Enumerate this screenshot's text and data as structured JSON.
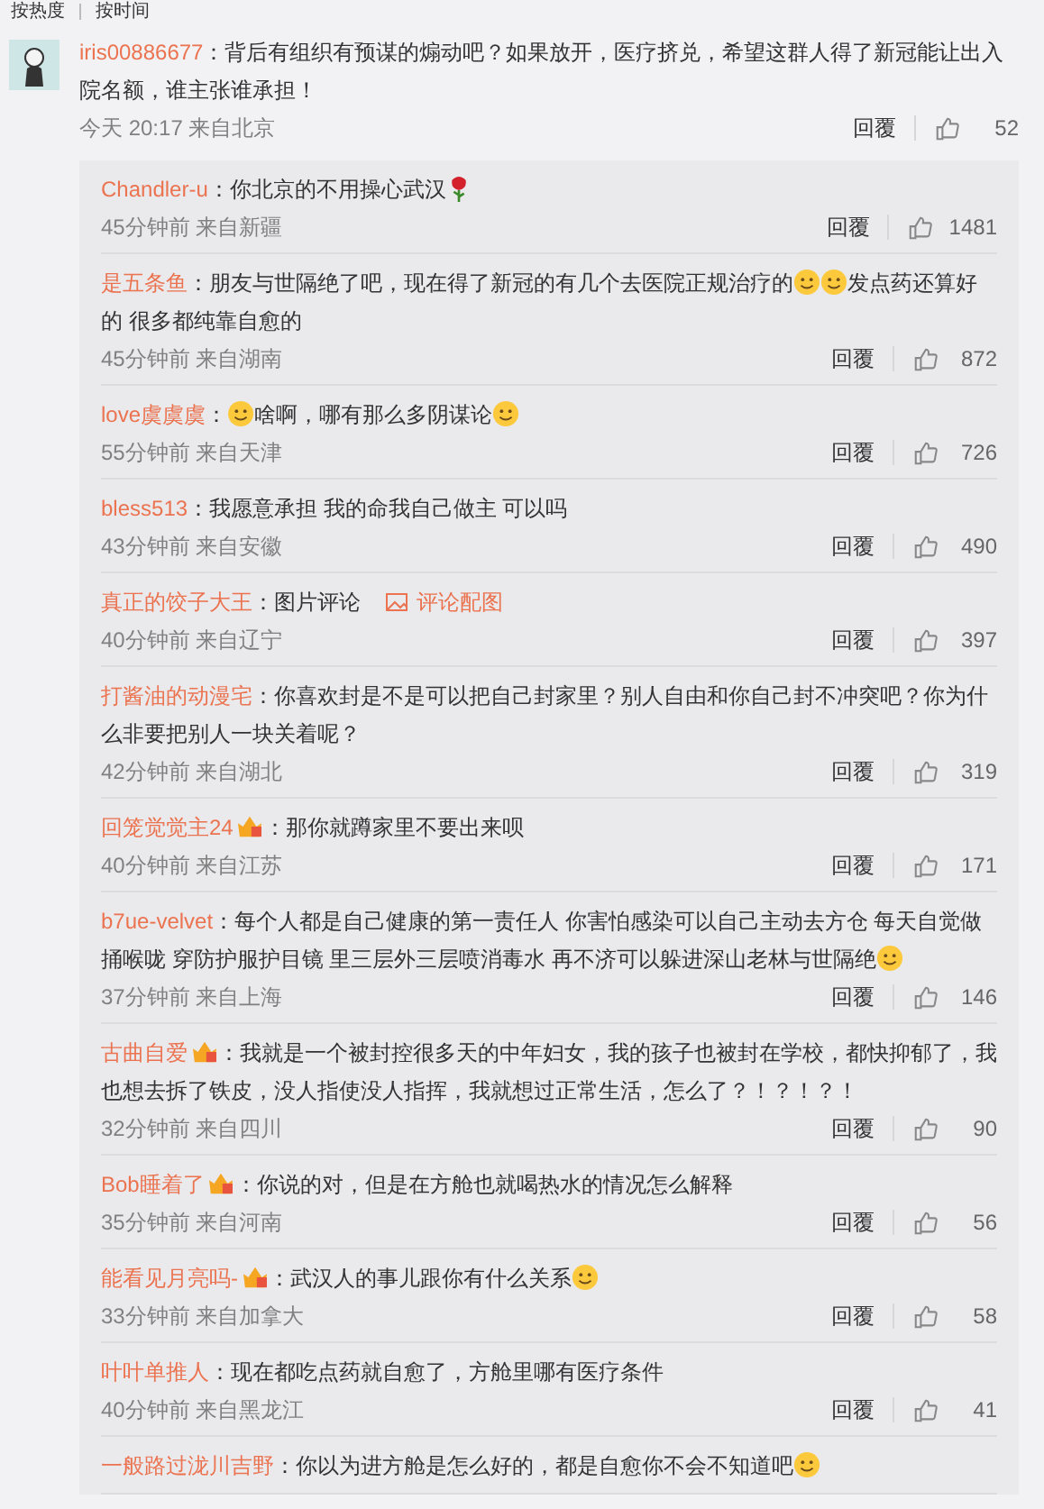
{
  "sort_tabs": [
    {
      "label": "按热度"
    },
    {
      "label": "按时间"
    }
  ],
  "comment": {
    "user": "iris00886677",
    "content": [
      {
        "kind": "text",
        "text": "：背后有组织有预谋的煽动吧？如果放开，医疗挤兑，希望这群人得了新冠能让出入院名额，谁主张谁承担！"
      }
    ],
    "time": "今天 20:17 来自北京",
    "reply": "回覆",
    "likes": "52"
  },
  "replies": [
    {
      "user": "Chandler-u",
      "vip_badge": false,
      "content": [
        {
          "kind": "text",
          "text": "：你北京的不用操心武汉"
        },
        {
          "kind": "flower"
        }
      ],
      "time": "45分钟前 来自新疆",
      "reply": "回覆",
      "likes": "1481"
    },
    {
      "user": "是五条鱼",
      "vip_badge": false,
      "content": [
        {
          "kind": "text",
          "text": "：朋友与世隔绝了吧，现在得了新冠的有几个去医院正规治疗的"
        },
        {
          "kind": "emoji"
        },
        {
          "kind": "emoji"
        },
        {
          "kind": "text",
          "text": "发点药还算好的 很多都纯靠自愈的"
        }
      ],
      "time": "45分钟前 来自湖南",
      "reply": "回覆",
      "likes": "872"
    },
    {
      "user": "love虞虞虞",
      "vip_badge": false,
      "content": [
        {
          "kind": "text",
          "text": "："
        },
        {
          "kind": "emoji"
        },
        {
          "kind": "text",
          "text": "啥啊，哪有那么多阴谋论"
        },
        {
          "kind": "emoji"
        }
      ],
      "time": "55分钟前 来自天津",
      "reply": "回覆",
      "likes": "726"
    },
    {
      "user": "bless513",
      "vip_badge": false,
      "content": [
        {
          "kind": "text",
          "text": "：我愿意承担 我的命我自己做主 可以吗"
        }
      ],
      "time": "43分钟前 来自安徽",
      "reply": "回覆",
      "likes": "490"
    },
    {
      "user": "真正的饺子大王",
      "vip_badge": false,
      "content": [
        {
          "kind": "text",
          "text": "：图片评论"
        },
        {
          "kind": "image_link",
          "text": "评论配图"
        }
      ],
      "time": "40分钟前 来自辽宁",
      "reply": "回覆",
      "likes": "397"
    },
    {
      "user": "打酱油的动漫宅",
      "vip_badge": false,
      "content": [
        {
          "kind": "text",
          "text": "：你喜欢封是不是可以把自己封家里？别人自由和你自己封不冲突吧？你为什么非要把别人一块关着呢？"
        }
      ],
      "time": "42分钟前 来自湖北",
      "reply": "回覆",
      "likes": "319"
    },
    {
      "user": "回笼觉觉主24",
      "vip_badge": true,
      "content": [
        {
          "kind": "text",
          "text": "：那你就蹲家里不要出来呗"
        }
      ],
      "time": "40分钟前 来自江苏",
      "reply": "回覆",
      "likes": "171"
    },
    {
      "user": "b7ue-velvet",
      "vip_badge": false,
      "content": [
        {
          "kind": "text",
          "text": "：每个人都是自己健康的第一责任人 你害怕感染可以自己主动去方仓 每天自觉做捅喉咙 穿防护服护目镜 里三层外三层喷消毒水 再不济可以躲进深山老林与世隔绝"
        },
        {
          "kind": "emoji"
        }
      ],
      "time": "37分钟前 来自上海",
      "reply": "回覆",
      "likes": "146"
    },
    {
      "user": "古曲自爱",
      "vip_badge": true,
      "content": [
        {
          "kind": "text",
          "text": "：我就是一个被封控很多天的中年妇女，我的孩子也被封在学校，都快抑郁了，我也想去拆了铁皮，没人指使没人指挥，我就想过正常生活，怎么了？！？！？！"
        }
      ],
      "time": "32分钟前 来自四川",
      "reply": "回覆",
      "likes": "90"
    },
    {
      "user": "Bob睡着了",
      "vip_badge": true,
      "content": [
        {
          "kind": "text",
          "text": "：你说的对，但是在方舱也就喝热水的情况怎么解释"
        }
      ],
      "time": "35分钟前 来自河南",
      "reply": "回覆",
      "likes": "56"
    },
    {
      "user": "能看见月亮吗-",
      "vip_badge": true,
      "content": [
        {
          "kind": "text",
          "text": "：武汉人的事儿跟你有什么关系"
        },
        {
          "kind": "emoji"
        }
      ],
      "time": "33分钟前 来自加拿大",
      "reply": "回覆",
      "likes": "58"
    },
    {
      "user": "叶叶单推人",
      "vip_badge": false,
      "content": [
        {
          "kind": "text",
          "text": "：现在都吃点药就自愈了，方舱里哪有医疗条件"
        }
      ],
      "time": "40分钟前 来自黑龙江",
      "reply": "回覆",
      "likes": "41"
    },
    {
      "user": "一般路过泷川吉野",
      "vip_badge": false,
      "content": [
        {
          "kind": "text",
          "text": "：你以为进方舱是怎么好的，都是自愈你不会不知道吧"
        },
        {
          "kind": "emoji"
        }
      ]
    }
  ]
}
